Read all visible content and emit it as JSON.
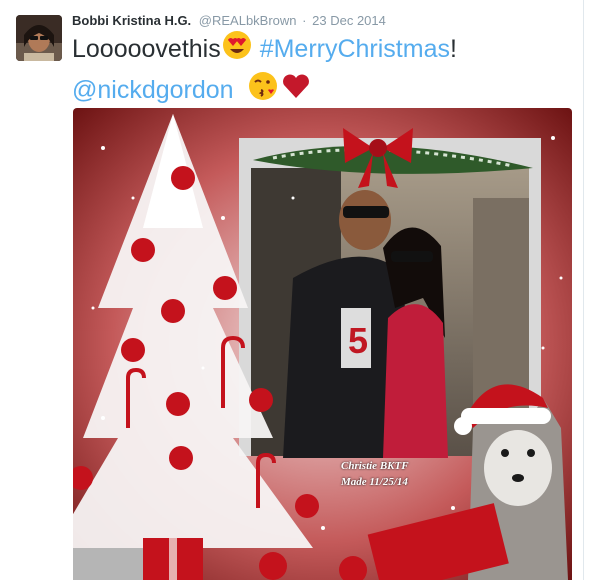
{
  "tweet": {
    "display_name": "Bobbi Kristina H.G.",
    "handle": "@REALbkBrown",
    "separator": "·",
    "date": "23 Dec 2014",
    "text_part1": "Looooovethis",
    "hashtag": "#MerryChristmas",
    "text_part2": "!",
    "mention": "@nickdgordon"
  },
  "media": {
    "watermark_line1": "Christie BKTF",
    "watermark_line2": "Made 11/25/14"
  },
  "colors": {
    "link": "#55acee",
    "text": "#292f33",
    "meta": "#8899a6"
  }
}
